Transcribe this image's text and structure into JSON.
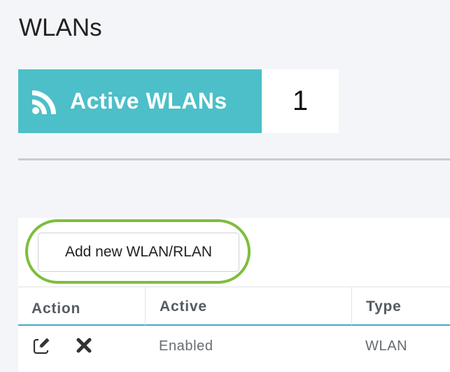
{
  "page": {
    "title": "WLANs"
  },
  "summary": {
    "label": "Active WLANs",
    "count": "1",
    "icon": "wifi-icon",
    "accent_color": "#4cbfc8"
  },
  "toolbar": {
    "add_label": "Add new WLAN/RLAN",
    "highlight_color": "#7dbe3c"
  },
  "table": {
    "columns": [
      "Action",
      "Active",
      "Type"
    ],
    "rows": [
      {
        "actions": [
          "edit-icon",
          "delete-icon"
        ],
        "active": "Enabled",
        "type": "WLAN"
      }
    ],
    "header_underline_color": "#3fa9c8"
  }
}
